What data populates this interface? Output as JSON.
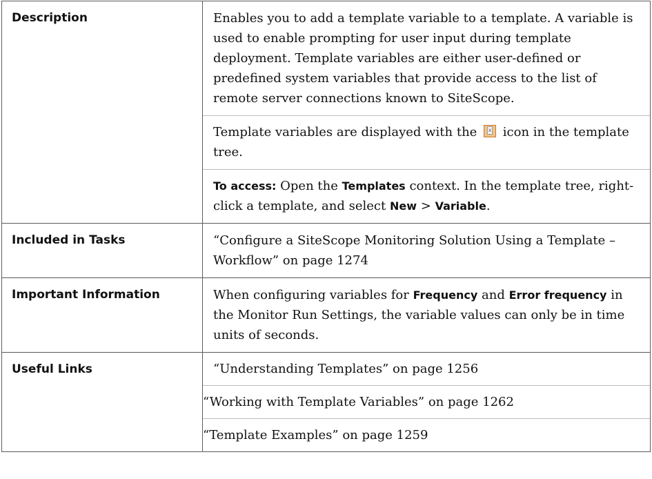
{
  "rows": [
    {
      "label": "Description",
      "description": {
        "p1": "Enables you to add a template variable to a template. A variable is used to enable prompting for user input during template deployment. Template variables are either user-defined or predefined system variables that provide access to the list of remote server connections known to SiteScope.",
        "p2_pre": "Template variables are displayed with the",
        "p2_icon": "variable-icon",
        "p2_post": "icon in the template tree.",
        "p3": {
          "access_label": "To access:",
          "t1": "Open the",
          "templates": "Templates",
          "t2": "context. In the template tree, right-click a template, and select",
          "new": "New",
          "gt": ">",
          "variable": "Variable",
          "end": "."
        }
      }
    },
    {
      "label": "Included in Tasks",
      "text": "“Configure a SiteScope Monitoring Solution Using a Template – Workflow” on page 1274"
    },
    {
      "label": "Important Information",
      "important": {
        "t1": "When configuring variables for",
        "frequency": "Frequency",
        "and": "and",
        "error_frequency": "Error frequency",
        "t2": "in the Monitor Run Settings, the variable values can only be in time units of seconds."
      }
    },
    {
      "label": "Useful Links",
      "links": [
        "“Understanding Templates” on page 1256",
        "“Working with Template Variables” on page 1262",
        "“Template Examples” on page 1259"
      ]
    }
  ]
}
